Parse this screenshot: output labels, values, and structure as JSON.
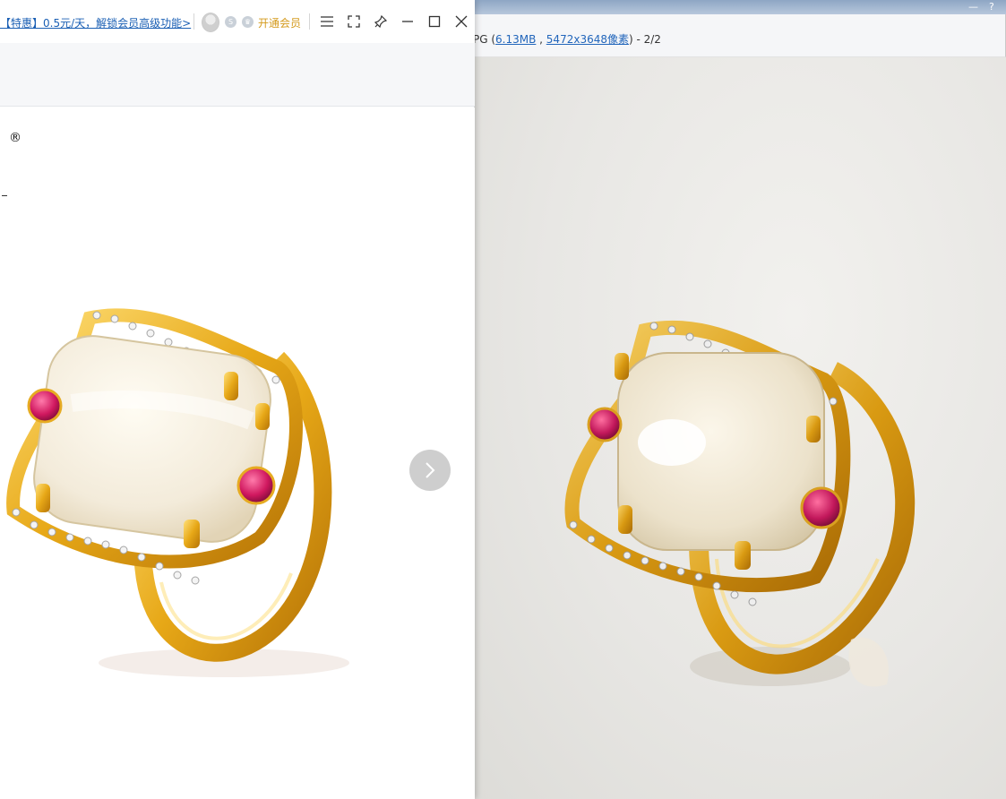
{
  "app": {
    "promo_text": "【特惠】0.5元/天，解锁会员高级功能>",
    "vip_label": "开通会员",
    "badges": [
      "S",
      "♛"
    ],
    "brand_reg_mark": "®"
  },
  "viewer": {
    "format_prefix": "PG (",
    "file_size": "6.13MB",
    "separator": " , ",
    "dimensions": "5472x3648像素",
    "page_indicator": ") - 2/2",
    "window_controls": [
      "—",
      "?"
    ]
  },
  "colors": {
    "promo_link": "#1a5fb4",
    "vip_gold": "#d49a1c",
    "ring_gold": "#e0a81a",
    "jade": "#f3ecdd",
    "ruby": "#c2185b"
  },
  "icons": [
    "user-avatar-icon",
    "menu-icon",
    "fullscreen-icon",
    "pin-icon",
    "minimize-icon",
    "maximize-icon",
    "close-icon",
    "chevron-right-icon"
  ]
}
